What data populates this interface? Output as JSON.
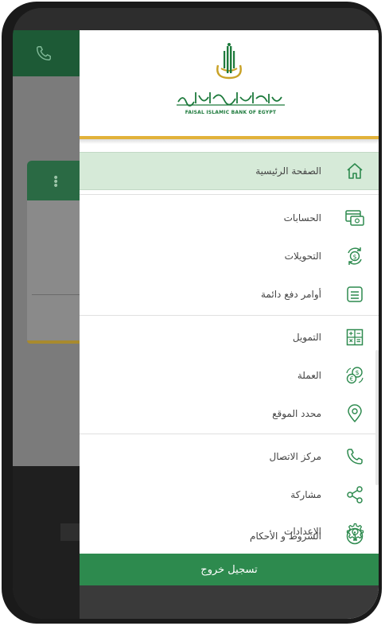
{
  "bank": {
    "name_arabic": "بنك فيصل الإسلامي المصري",
    "name_english": "FAISAL ISLAMIC BANK OF EGYPT"
  },
  "colors": {
    "brand_green": "#2d8a4e",
    "active_bg": "#d6ead8",
    "accent_gold": "#e2b23a",
    "icon_green": "#2d8a4e"
  },
  "menu": {
    "items": [
      {
        "label": "الصفحة الرئيسية",
        "icon": "home-icon",
        "active": true
      },
      {
        "label": "الحسابات",
        "icon": "accounts-icon",
        "active": false
      },
      {
        "label": "التحويلات",
        "icon": "transfer-icon",
        "active": false
      },
      {
        "label": "أوامر دفع دائمة",
        "icon": "standing-order-icon",
        "active": false
      },
      {
        "label": "التمويل",
        "icon": "calculator-icon",
        "active": false
      },
      {
        "label": "العملة",
        "icon": "currency-icon",
        "active": false
      },
      {
        "label": "محدد الموقع",
        "icon": "location-icon",
        "active": false
      },
      {
        "label": "مركز الاتصال",
        "icon": "phone-icon",
        "active": false
      },
      {
        "label": "مشاركة",
        "icon": "share-icon",
        "active": false
      },
      {
        "label": "الإعدادات",
        "icon": "gear-icon",
        "active": false
      },
      {
        "label": "الشروط و الأحكام",
        "icon": "info-icon",
        "active": false
      }
    ]
  },
  "logout": {
    "label": "تسجيل خروج"
  }
}
